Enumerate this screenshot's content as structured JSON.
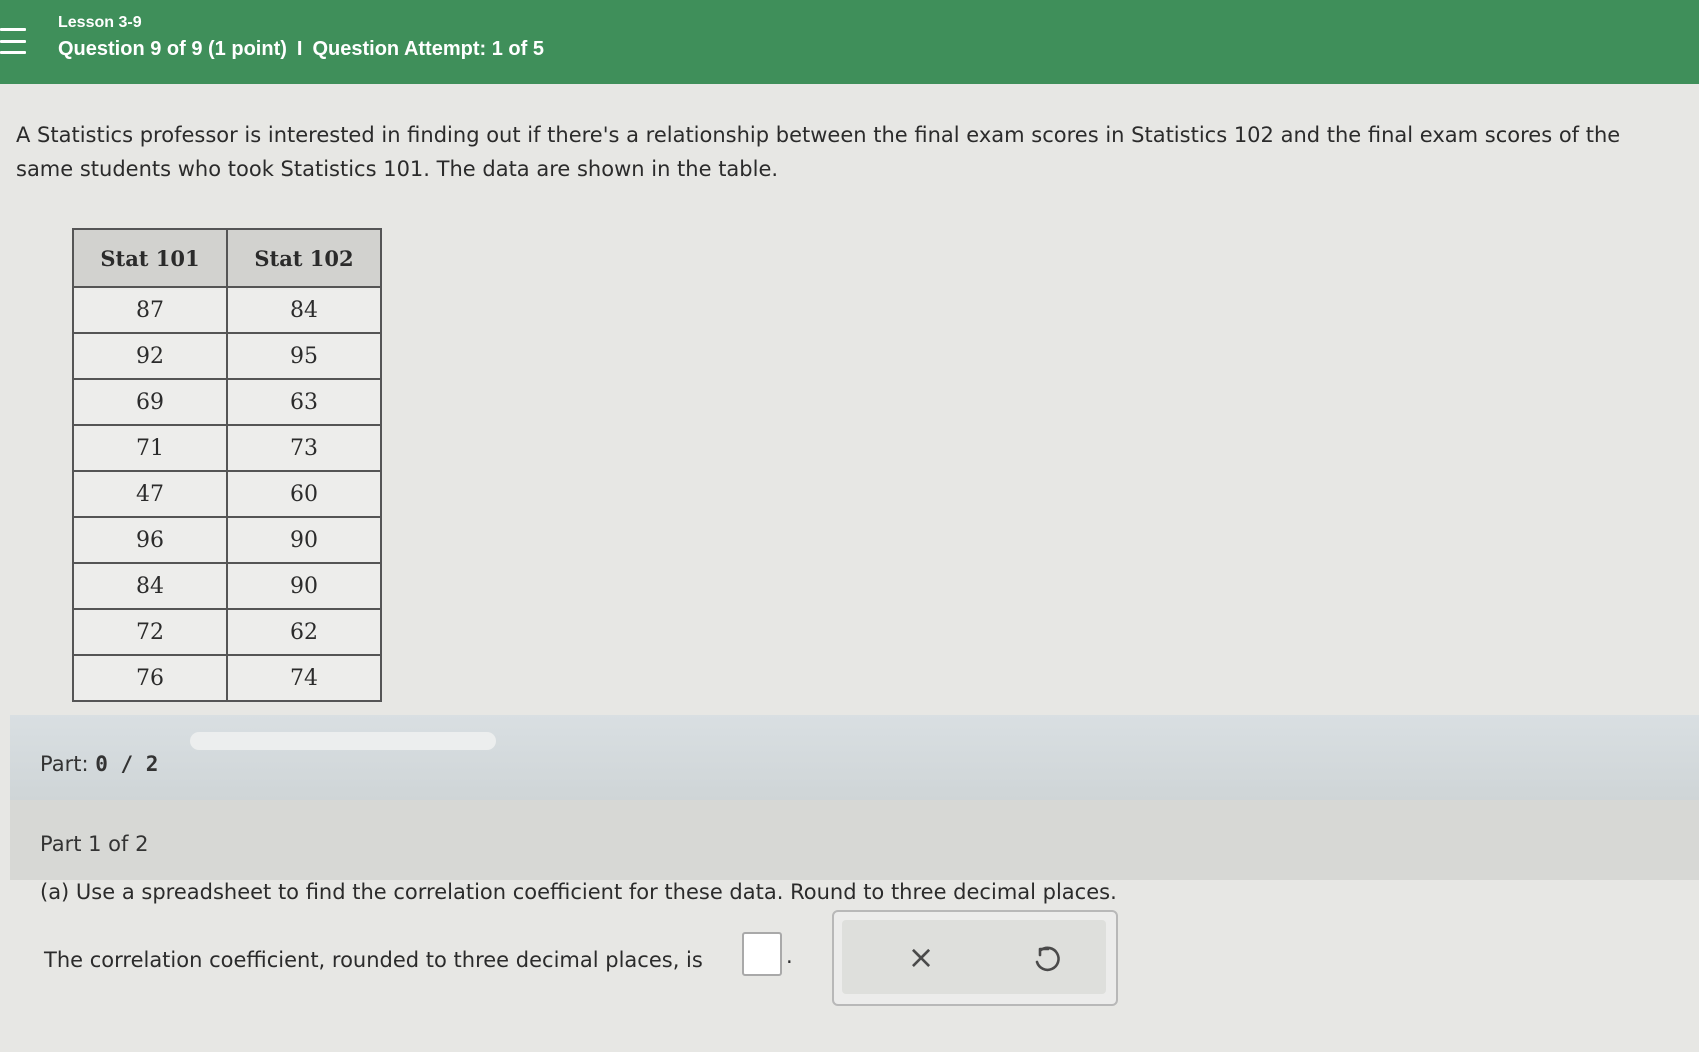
{
  "header": {
    "lesson": "Lesson 3-9",
    "question": "Question 9 of 9 (1 point)",
    "separator": "I",
    "attempt": "Question Attempt: 1 of 5"
  },
  "prompt": "A Statistics professor is interested in finding out if there's a relationship between the final exam scores in Statistics 102 and the final exam scores of the same students who took Statistics 101. The data are shown in the table.",
  "table": {
    "headers": [
      "Stat 101",
      "Stat 102"
    ],
    "rows": [
      [
        "87",
        "84"
      ],
      [
        "92",
        "95"
      ],
      [
        "69",
        "63"
      ],
      [
        "71",
        "73"
      ],
      [
        "47",
        "60"
      ],
      [
        "96",
        "90"
      ],
      [
        "84",
        "90"
      ],
      [
        "72",
        "62"
      ],
      [
        "76",
        "74"
      ]
    ]
  },
  "part": {
    "label": "Part:",
    "value": "0 / 2",
    "progress_fraction": 0
  },
  "part1": {
    "label": "Part 1 of 2",
    "question": "(a) Use a spreadsheet to find the correlation coefficient for these data. Round to three decimal places.",
    "answer_text": "The correlation coefficient, rounded to three decimal places, is",
    "answer_value": "",
    "period": "."
  },
  "actions": {
    "clear_glyph": "×"
  },
  "colors": {
    "header_bg": "#3f8f5a"
  }
}
